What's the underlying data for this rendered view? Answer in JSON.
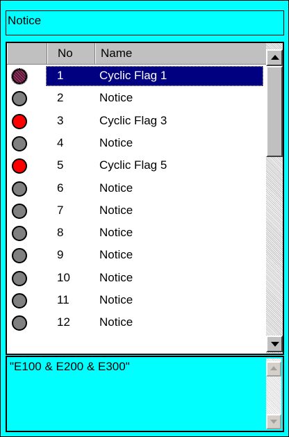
{
  "title_field": {
    "value": "Notice"
  },
  "list": {
    "columns": [
      {
        "key": "icon",
        "label": ""
      },
      {
        "key": "no",
        "label": "No"
      },
      {
        "key": "name",
        "label": "Name"
      }
    ],
    "rows": [
      {
        "no": "1",
        "name": "Cyclic Flag 1",
        "status": "selected",
        "color": "#800040"
      },
      {
        "no": "2",
        "name": "Notice",
        "status": "off",
        "color": "#808080"
      },
      {
        "no": "3",
        "name": "Cyclic Flag 3",
        "status": "on",
        "color": "#ff0000"
      },
      {
        "no": "4",
        "name": "Notice",
        "status": "off",
        "color": "#808080"
      },
      {
        "no": "5",
        "name": "Cyclic Flag 5",
        "status": "on",
        "color": "#ff0000"
      },
      {
        "no": "6",
        "name": "Notice",
        "status": "off",
        "color": "#808080"
      },
      {
        "no": "7",
        "name": "Notice",
        "status": "off",
        "color": "#808080"
      },
      {
        "no": "8",
        "name": "Notice",
        "status": "off",
        "color": "#808080"
      },
      {
        "no": "9",
        "name": "Notice",
        "status": "off",
        "color": "#808080"
      },
      {
        "no": "10",
        "name": "Notice",
        "status": "off",
        "color": "#808080"
      },
      {
        "no": "11",
        "name": "Notice",
        "status": "off",
        "color": "#808080"
      },
      {
        "no": "12",
        "name": "Notice",
        "status": "off",
        "color": "#808080"
      }
    ],
    "selected_index": 0,
    "icons": {
      "scroll_up": "scroll-up-arrow-icon",
      "scroll_down": "scroll-down-arrow-icon",
      "status": "status-circle-icon"
    }
  },
  "expression": {
    "value": "\"E100 & E200 & E300\""
  },
  "colors": {
    "background": "#00ffff",
    "selection": "#000080",
    "flag_on": "#ff0000",
    "flag_off": "#808080",
    "header": "#c0c0c0"
  }
}
